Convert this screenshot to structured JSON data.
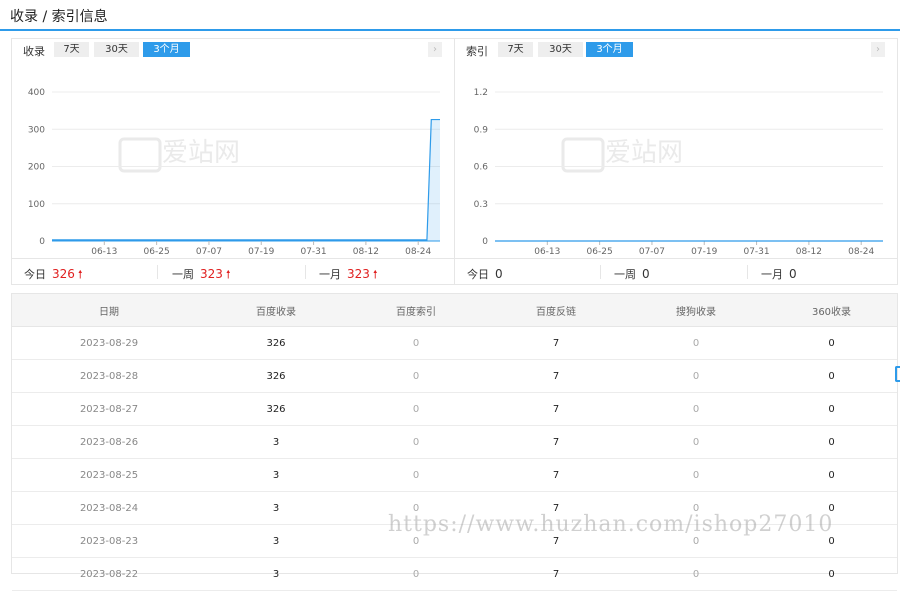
{
  "page": {
    "title": "收录 / 索引信息"
  },
  "left_chart": {
    "label": "收录",
    "tabs": [
      {
        "label": "7天",
        "active": false
      },
      {
        "label": "30天",
        "active": false
      },
      {
        "label": "3个月",
        "active": true
      }
    ],
    "chevron": "›",
    "watermark": "爱站网",
    "stats": [
      {
        "label": "今日",
        "value": "326",
        "trend": "up"
      },
      {
        "label": "一周",
        "value": "323",
        "trend": "up"
      },
      {
        "label": "一月",
        "value": "323",
        "trend": "up"
      }
    ]
  },
  "right_chart": {
    "label": "索引",
    "tabs": [
      {
        "label": "7天",
        "active": false
      },
      {
        "label": "30天",
        "active": false
      },
      {
        "label": "3个月",
        "active": true
      }
    ],
    "chevron": "›",
    "watermark": "爱站网",
    "stats": [
      {
        "label": "今日",
        "value": "0",
        "trend": ""
      },
      {
        "label": "一周",
        "value": "0",
        "trend": ""
      },
      {
        "label": "一月",
        "value": "0",
        "trend": ""
      }
    ]
  },
  "chart_data": [
    {
      "type": "area",
      "title": "",
      "xlabel": "",
      "ylabel": "",
      "x_ticks": [
        "06-13",
        "06-25",
        "07-07",
        "07-19",
        "07-31",
        "08-12",
        "08-24"
      ],
      "y_ticks": [
        "0",
        "100",
        "200",
        "300",
        "400"
      ],
      "ylim": [
        0,
        400
      ],
      "grid": true,
      "series": [
        {
          "x": [
            "06-01",
            "08-26",
            "08-27",
            "08-28",
            "08-29"
          ],
          "values": [
            3,
            3,
            326,
            326,
            326
          ]
        }
      ],
      "color": "#2e9bea"
    },
    {
      "type": "line",
      "title": "",
      "xlabel": "",
      "ylabel": "",
      "x_ticks": [
        "06-13",
        "06-25",
        "07-07",
        "07-19",
        "07-31",
        "08-12",
        "08-24"
      ],
      "y_ticks": [
        "0",
        "0.3",
        "0.6",
        "0.9",
        "1.2"
      ],
      "ylim": [
        0,
        1.2
      ],
      "grid": true,
      "series": [
        {
          "x": [
            "06-01",
            "08-29"
          ],
          "values": [
            0,
            0
          ]
        }
      ],
      "color": "#2e9bea"
    }
  ],
  "table": {
    "headers": [
      "日期",
      "百度收录",
      "百度索引",
      "百度反链",
      "搜狗收录",
      "360收录"
    ],
    "rows": [
      [
        "2023-08-29",
        "326",
        "0",
        "7",
        "0",
        "0"
      ],
      [
        "2023-08-28",
        "326",
        "0",
        "7",
        "0",
        "0"
      ],
      [
        "2023-08-27",
        "326",
        "0",
        "7",
        "0",
        "0"
      ],
      [
        "2023-08-26",
        "3",
        "0",
        "7",
        "0",
        "0"
      ],
      [
        "2023-08-25",
        "3",
        "0",
        "7",
        "0",
        "0"
      ],
      [
        "2023-08-24",
        "3",
        "0",
        "7",
        "0",
        "0"
      ],
      [
        "2023-08-23",
        "3",
        "0",
        "7",
        "0",
        "0"
      ],
      [
        "2023-08-22",
        "3",
        "0",
        "7",
        "0",
        "0"
      ]
    ]
  },
  "watermark_text": "https://www.huzhan.com/ishop27010"
}
